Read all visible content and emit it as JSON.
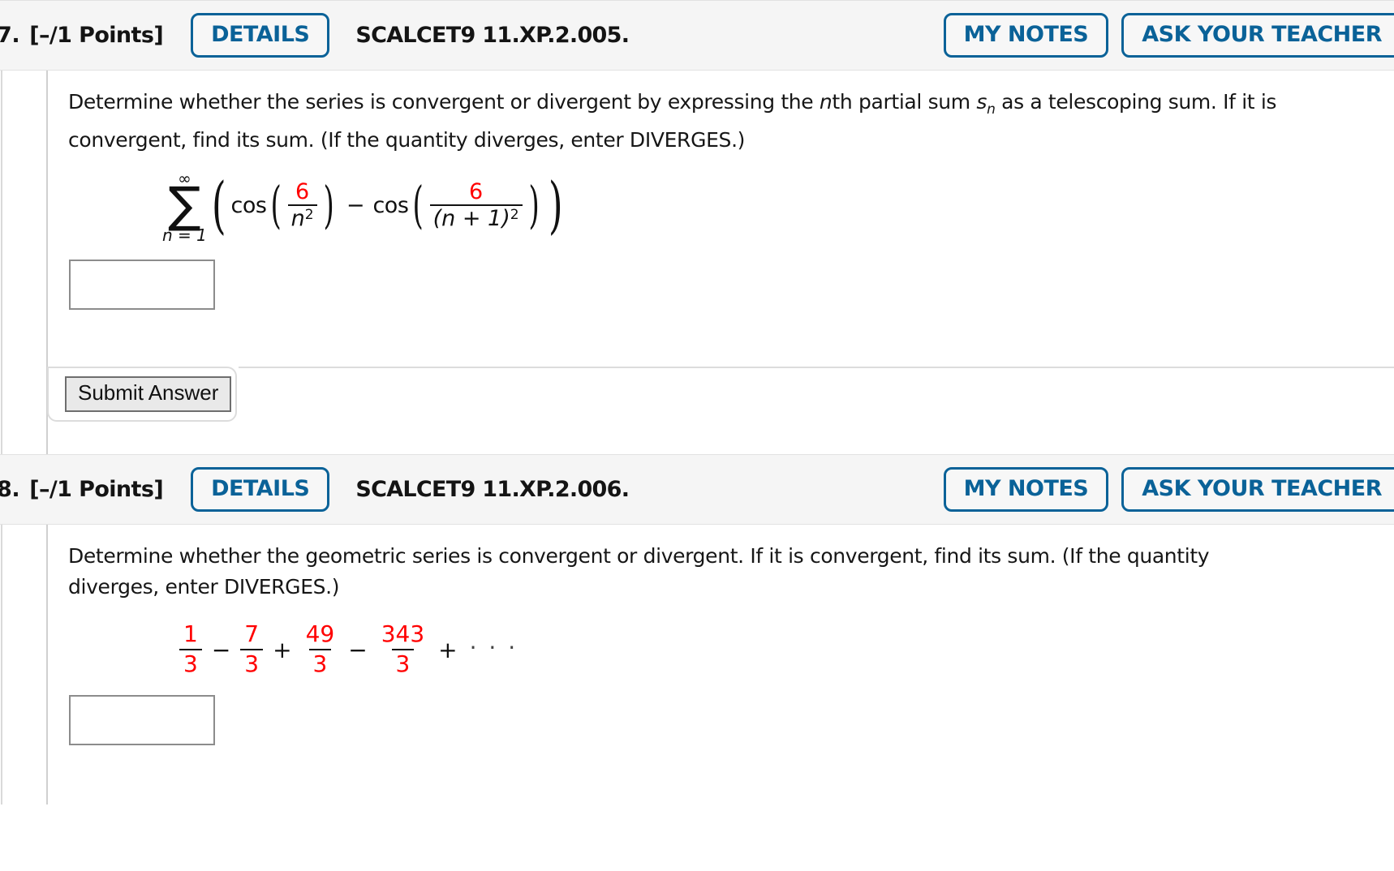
{
  "problems": [
    {
      "number": "7.",
      "points": "[–/1 Points]",
      "details_label": "DETAILS",
      "code": "SCALCET9 11.XP.2.005.",
      "my_notes_label": "MY NOTES",
      "ask_teacher_label": "ASK YOUR TEACHER",
      "question_part1": "Determine whether the series is convergent or divergent by expressing the ",
      "question_italic_n": "n",
      "question_part2": "th partial sum ",
      "question_s": "s",
      "question_sub_n": "n",
      "question_part3": " as a telescoping sum. If it is convergent, find its sum. (If the quantity diverges, enter DIVERGES.)",
      "math": {
        "sum_upper": "∞",
        "sum_lower": "n = 1",
        "term1_fn": "cos",
        "term1_num": "6",
        "term1_den_base": "n",
        "term1_den_exp": "2",
        "operator": "−",
        "term2_fn": "cos",
        "term2_num": "6",
        "term2_den_base": "(n + 1)",
        "term2_den_exp": "2"
      },
      "answer_value": "",
      "answer_placeholder": "",
      "submit_label": "Submit Answer"
    },
    {
      "number": "8.",
      "points": "[–/1 Points]",
      "details_label": "DETAILS",
      "code": "SCALCET9 11.XP.2.006.",
      "my_notes_label": "MY NOTES",
      "ask_teacher_label": "ASK YOUR TEACHER",
      "question_text": "Determine whether the geometric series is convergent or divergent. If it is convergent, find its sum. (If the quantity diverges, enter DIVERGES.)",
      "series": {
        "terms": [
          {
            "num": "1",
            "den": "3"
          },
          {
            "num": "7",
            "den": "3"
          },
          {
            "num": "49",
            "den": "3"
          },
          {
            "num": "343",
            "den": "3"
          }
        ],
        "operators": [
          "−",
          "+",
          "−"
        ],
        "trailing_operator": "+",
        "ellipsis": "· · ·"
      },
      "answer_value": "",
      "answer_placeholder": ""
    }
  ],
  "colors": {
    "accent_blue": "#0a6298",
    "math_red": "#ff0000",
    "header_bg": "#f5f5f5",
    "border_gray": "#8c8c8c"
  }
}
